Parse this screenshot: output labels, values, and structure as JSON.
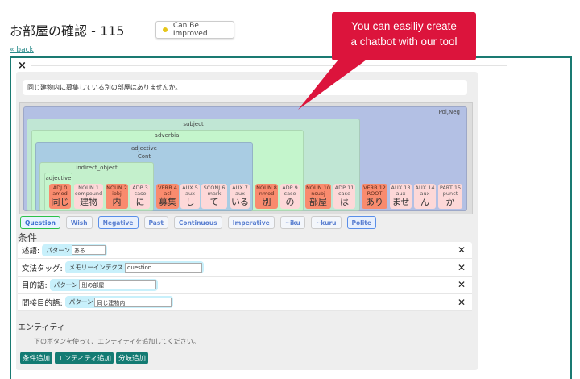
{
  "header": {
    "title": "お部屋の確認 - 115",
    "status": "Can Be Improved",
    "status_color": "#e6c619",
    "back_link": "« back"
  },
  "callout": {
    "line1": "You can easiliy create",
    "line2": "a chatbot with our tool",
    "color": "#dc143c"
  },
  "close_label": "×",
  "sentence": "同じ建物内に募集している別の部屋はありませんか。",
  "tree": {
    "boxes": [
      {
        "label": "Pol,Neg"
      },
      {
        "label": "subject"
      },
      {
        "label": "adverbial"
      },
      {
        "label": "adjective",
        "sub": "Cont"
      },
      {
        "label": "indirect_object"
      },
      {
        "label": "adjective"
      }
    ],
    "tokens": [
      {
        "pos": "ADJ 0",
        "dep": "amod",
        "word": "同じ"
      },
      {
        "pos": "NOUN 1",
        "dep": "compound",
        "word": "建物"
      },
      {
        "pos": "NOUN 2",
        "dep": "iobj",
        "word": "内"
      },
      {
        "pos": "ADP 3",
        "dep": "case",
        "word": "に"
      },
      {
        "pos": "VERB 4",
        "dep": "acl",
        "word": "募集"
      },
      {
        "pos": "AUX 5",
        "dep": "aux",
        "word": "し"
      },
      {
        "pos": "SCONJ 6",
        "dep": "mark",
        "word": "て"
      },
      {
        "pos": "AUX 7",
        "dep": "aux",
        "word": "いる"
      },
      {
        "pos": "NOUN 8",
        "dep": "nmod",
        "word": "別"
      },
      {
        "pos": "ADP 9",
        "dep": "case",
        "word": "の"
      },
      {
        "pos": "NOUN 10",
        "dep": "nsubj",
        "word": "部屋"
      },
      {
        "pos": "ADP 11",
        "dep": "case",
        "word": "は"
      },
      {
        "pos": "VERB 12",
        "dep": "ROOT",
        "word": "あり"
      },
      {
        "pos": "AUX 13",
        "dep": "aux",
        "word": "ませ"
      },
      {
        "pos": "AUX 14",
        "dep": "aux",
        "word": "ん"
      },
      {
        "pos": "PART 15",
        "dep": "punct",
        "word": "か"
      }
    ]
  },
  "tags": [
    {
      "label": "Question",
      "state": "green"
    },
    {
      "label": "Wish",
      "state": ""
    },
    {
      "label": "Negative",
      "state": "blue"
    },
    {
      "label": "Past",
      "state": ""
    },
    {
      "label": "Continuous",
      "state": ""
    },
    {
      "label": "Imperative",
      "state": ""
    },
    {
      "label": "~iku",
      "state": ""
    },
    {
      "label": "~kuru",
      "state": ""
    },
    {
      "label": "Polite",
      "state": "blue"
    }
  ],
  "conditions": {
    "title": "条件",
    "rows": [
      {
        "label": "述語:",
        "type": "パターン",
        "value": "ある"
      },
      {
        "label": "文法タッグ:",
        "type": "メモリーインデクス",
        "value": "question"
      },
      {
        "label": "目的語:",
        "type": "パターン",
        "value": "別の部屋"
      },
      {
        "label": "間接目的語:",
        "type": "パターン",
        "value": "同じ建物内"
      }
    ],
    "remove_label": "✕"
  },
  "entity": {
    "title": "エンティティ",
    "hint": "下のボタンを使って、エンティティを追加してください。"
  },
  "buttons": [
    "条件追加",
    "エンティティ追加",
    "分岐追加"
  ]
}
